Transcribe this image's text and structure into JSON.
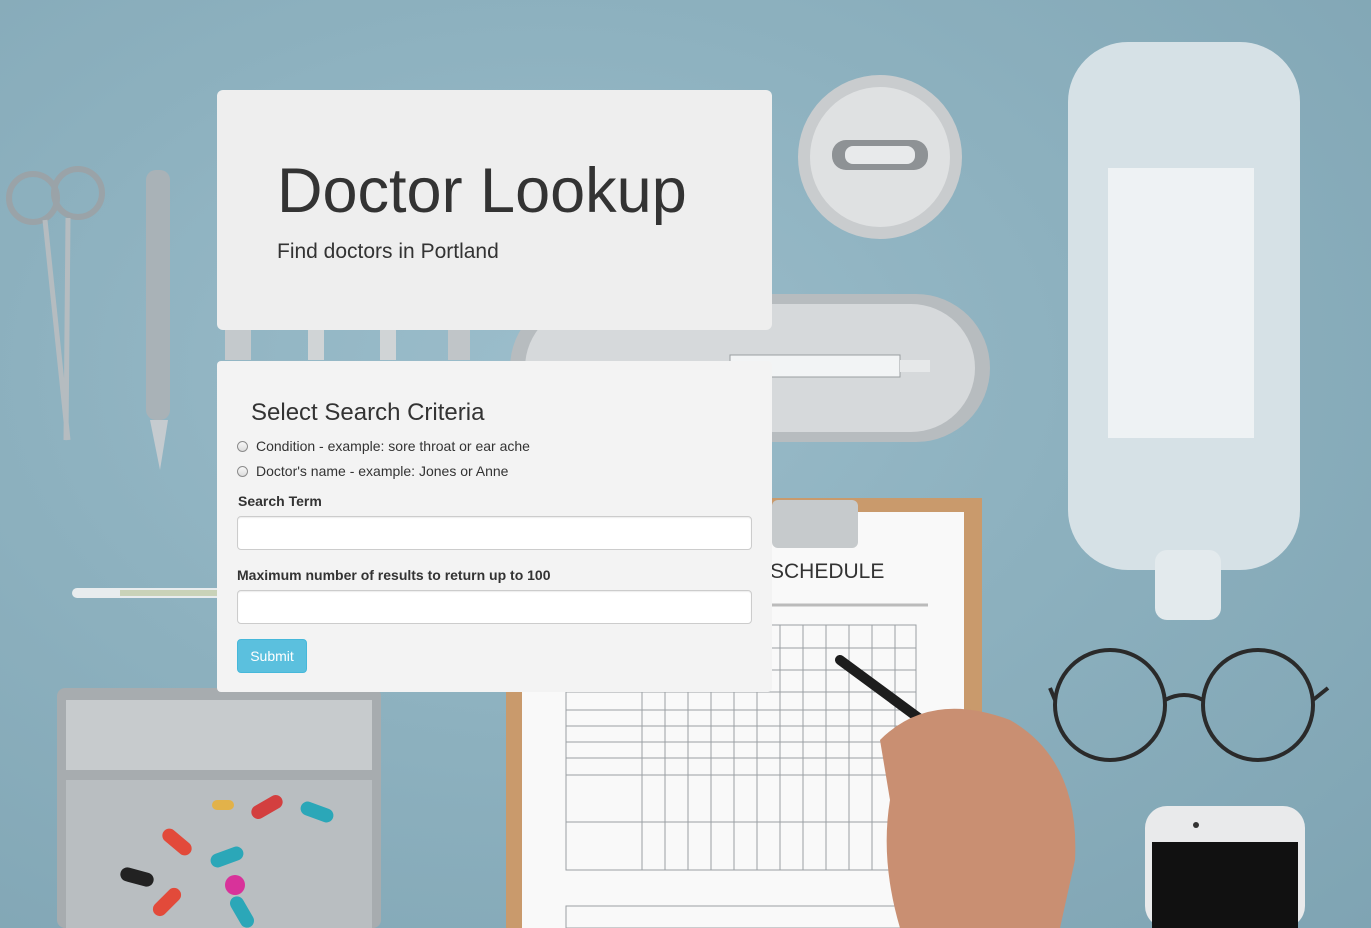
{
  "header": {
    "title": "Doctor Lookup",
    "subtitle": "Find doctors in Portland"
  },
  "form": {
    "heading": "Select Search Criteria",
    "options": [
      {
        "label": "Condition - example: sore throat or ear ache",
        "selected": false
      },
      {
        "label": "Doctor's name - example: Jones or Anne",
        "selected": false
      }
    ],
    "search_term_label": "Search Term",
    "search_term_value": "",
    "max_results_label": "Maximum number of results to return up to 100",
    "max_results_value": "",
    "submit_label": "Submit"
  },
  "background": {
    "schedule_heading": "SCHEDULE",
    "colors": {
      "desk": "#86aab8",
      "button": "#5bc0de",
      "panel": "#eeeeee"
    }
  }
}
